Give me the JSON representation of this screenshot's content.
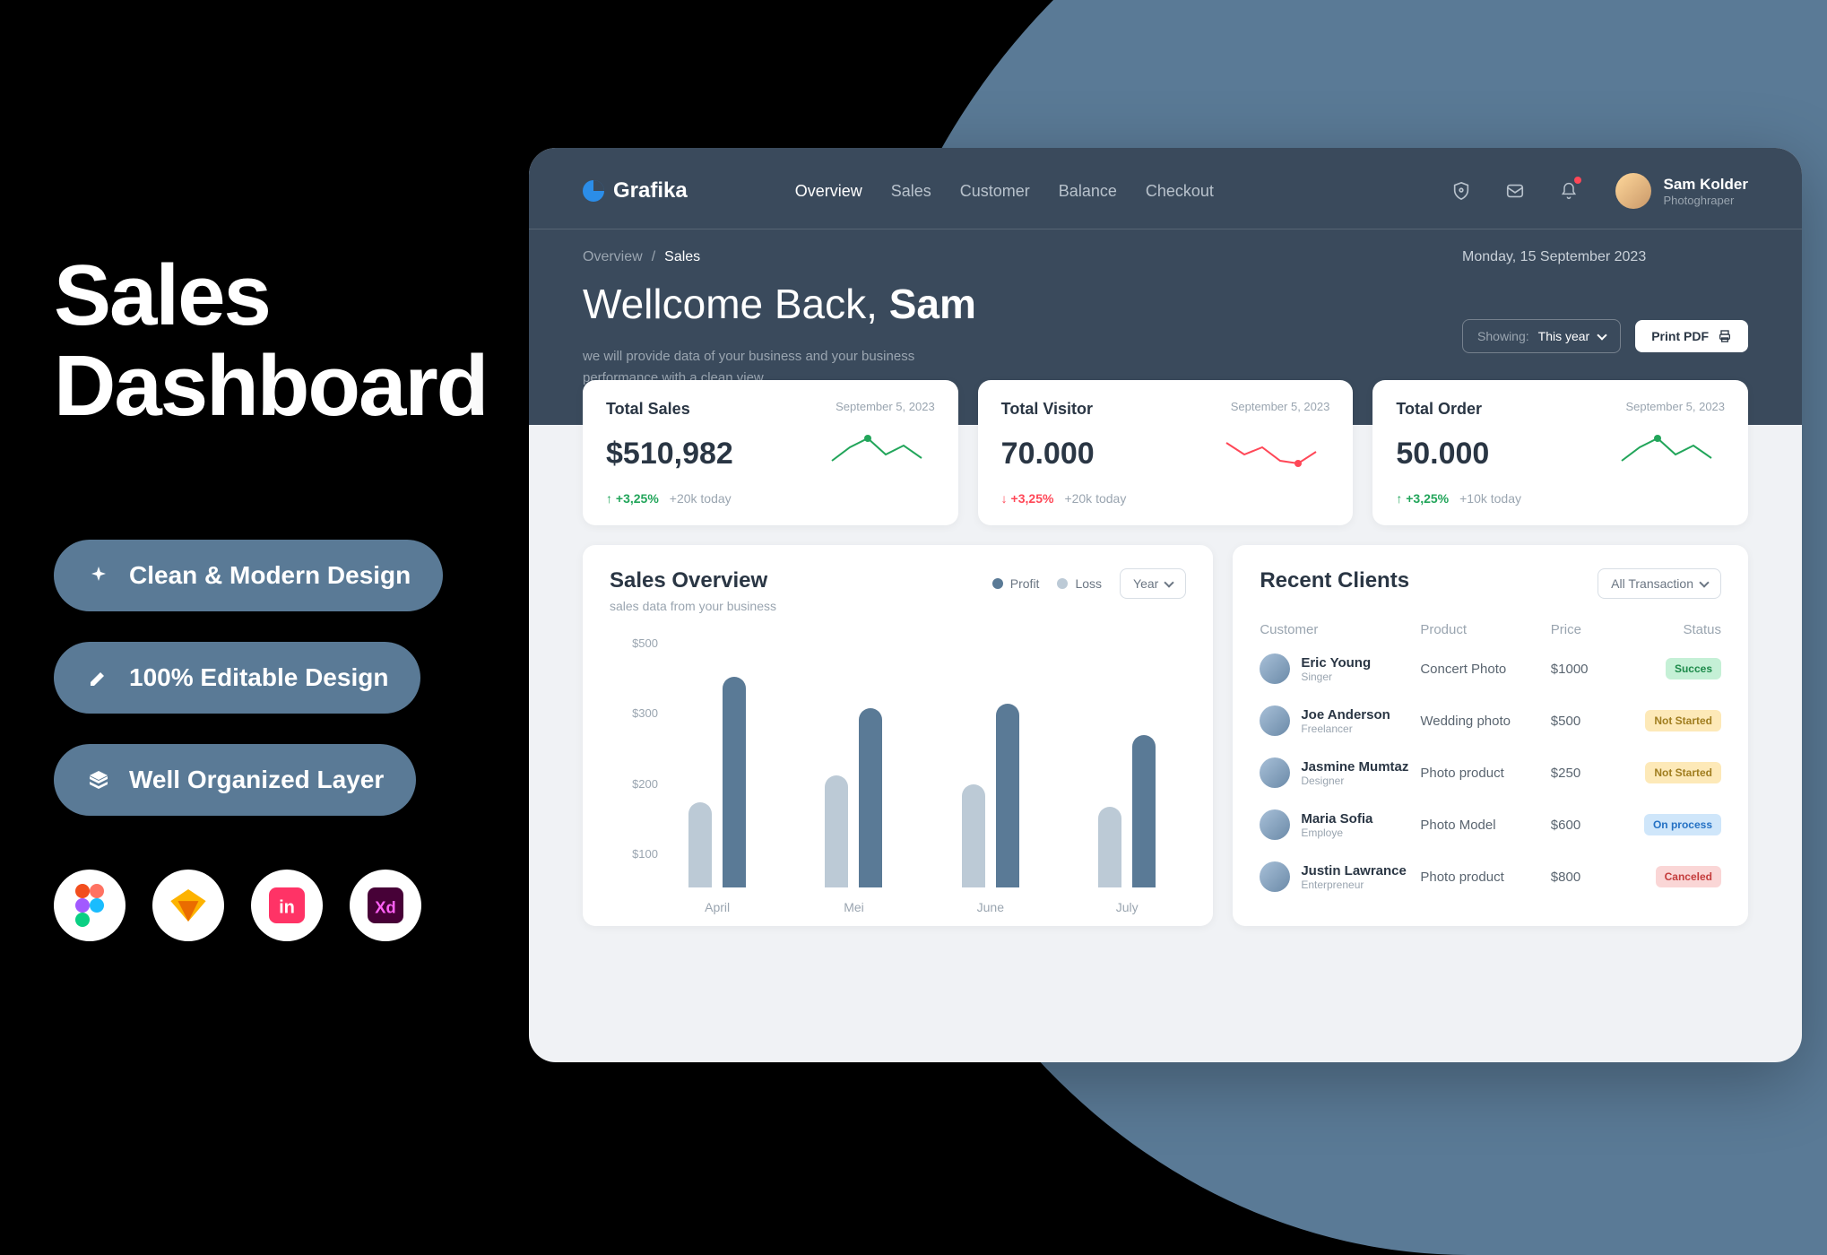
{
  "promo": {
    "title_line1": "Sales",
    "title_line2": "Dashboard",
    "pills": [
      {
        "icon": "sparkle-icon",
        "label": "Clean & Modern  Design"
      },
      {
        "icon": "pen-icon",
        "label": "100% Editable Design"
      },
      {
        "icon": "layers-icon",
        "label": "Well Organized Layer"
      }
    ],
    "tools": [
      {
        "name": "figma-icon",
        "color": "#a259ff"
      },
      {
        "name": "sketch-icon",
        "color": "#f7b500"
      },
      {
        "name": "invision-icon",
        "color": "#ff3366"
      },
      {
        "name": "xd-icon",
        "color": "#470137"
      }
    ]
  },
  "app": {
    "brand": "Grafika",
    "nav": [
      "Overview",
      "Sales",
      "Customer",
      "Balance",
      "Checkout"
    ],
    "user": {
      "name": "Sam Kolder",
      "role": "Photoghraper"
    }
  },
  "header": {
    "crumbs": [
      "Overview",
      "Sales"
    ],
    "date": "Monday, 15 September 2023",
    "welcome_prefix": "Wellcome Back, ",
    "welcome_name": "Sam",
    "subtext_line1": "we will provide data of your business and your business",
    "subtext_line2": "performance with a clean view",
    "showing_label": "Showing:",
    "showing_value": "This year",
    "print_label": "Print PDF"
  },
  "stats": [
    {
      "title": "Total Sales",
      "date": "September 5, 2023",
      "value": "$510,982",
      "delta": "+3,25%",
      "direction": "up",
      "today": "+20k today",
      "spark_color": "#22a55a"
    },
    {
      "title": "Total Visitor",
      "date": "September 5, 2023",
      "value": "70.000",
      "delta": "+3,25%",
      "direction": "down",
      "today": "+20k today",
      "spark_color": "#ff4757"
    },
    {
      "title": "Total Order",
      "date": "September 5, 2023",
      "value": "50.000",
      "delta": "+3,25%",
      "direction": "up",
      "today": "+10k today",
      "spark_color": "#22a55a"
    }
  ],
  "overview": {
    "title": "Sales Overview",
    "subtitle": "sales data from your business",
    "legend_profit": "Profit",
    "legend_loss": "Loss",
    "period": "Year"
  },
  "chart_data": {
    "type": "bar",
    "categories": [
      "April",
      "Mei",
      "June",
      "July"
    ],
    "series": [
      {
        "name": "Loss",
        "values": [
          190,
          250,
          230,
          180
        ]
      },
      {
        "name": "Profit",
        "values": [
          470,
          400,
          410,
          340
        ]
      }
    ],
    "ylabel": "",
    "ylim": [
      0,
      500
    ],
    "y_ticks": [
      "$500",
      "$300",
      "$200",
      "$100"
    ]
  },
  "clients": {
    "title": "Recent Clients",
    "filter": "All Transaction",
    "columns": [
      "Customer",
      "Product",
      "Price",
      "Status"
    ],
    "rows": [
      {
        "name": "Eric Young",
        "role": "Singer",
        "product": "Concert Photo",
        "price": "$1000",
        "status": "Succes",
        "status_class": "st-success"
      },
      {
        "name": "Joe Anderson",
        "role": "Freelancer",
        "product": "Wedding photo",
        "price": "$500",
        "status": "Not Started",
        "status_class": "st-notstarted"
      },
      {
        "name": "Jasmine Mumtaz",
        "role": "Designer",
        "product": "Photo product",
        "price": "$250",
        "status": "Not Started",
        "status_class": "st-notstarted"
      },
      {
        "name": "Maria Sofia",
        "role": "Employe",
        "product": "Photo Model",
        "price": "$600",
        "status": "On process",
        "status_class": "st-process"
      },
      {
        "name": "Justin Lawrance",
        "role": "Enterpreneur",
        "product": "Photo product",
        "price": "$800",
        "status": "Canceled",
        "status_class": "st-cancel"
      }
    ]
  }
}
